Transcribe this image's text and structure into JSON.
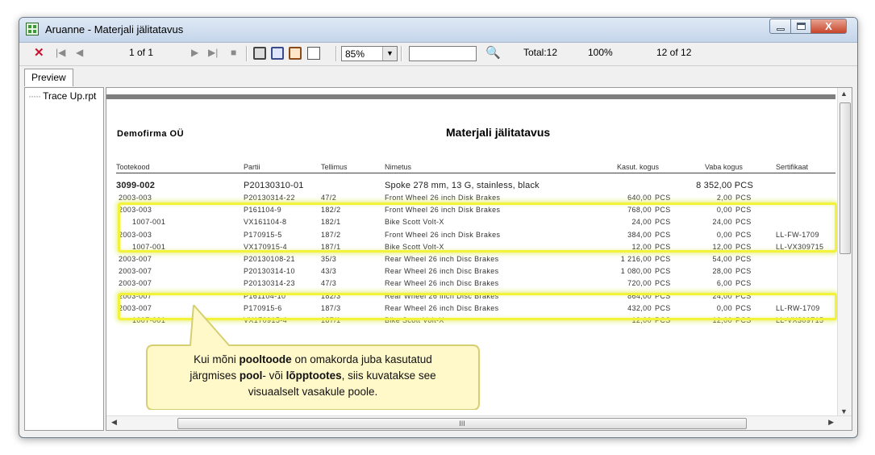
{
  "window": {
    "title": "Aruanne - Materjali jälitatavus",
    "min_label": "",
    "max_label": "",
    "close_label": "X"
  },
  "toolbar": {
    "close_symbol": "✕",
    "first_symbol": "|◀",
    "prev_symbol": "◀",
    "page_indicator": "1 of 1",
    "next_symbol": "▶",
    "last_symbol": "▶|",
    "stop_symbol": "■",
    "zoom_value": "85%",
    "search_value": "",
    "find_symbol": "🔍",
    "total": "Total:12",
    "percent": "100%",
    "records": "12 of 12"
  },
  "tabs": [
    {
      "label": "Preview"
    }
  ],
  "tree": {
    "item": "Trace Up.rpt"
  },
  "report": {
    "company": "Demofirma OÜ",
    "title": "Materjali jälitatavus",
    "columns": {
      "code": "Tootekood",
      "lot": "Partii",
      "order": "Tellimus",
      "name": "Nimetus",
      "used": "Kasut. kogus",
      "free": "Vaba kogus",
      "cert": "Sertifikaat"
    },
    "main_row": {
      "code": "3099-002",
      "lot": "P20130310-01",
      "name": "Spoke 278 mm, 13 G, stainless, black",
      "free": "8 352,00 PCS"
    },
    "rows": [
      {
        "code": "2003-003",
        "lot": "P20130314-22",
        "order": "47/2",
        "name": "Front Wheel 26 inch Disk Brakes",
        "used": "640,00",
        "used_unit": "PCS",
        "free": "2,00",
        "free_unit": "PCS",
        "cert": ""
      },
      {
        "code": "2003-003",
        "lot": "P161104-9",
        "order": "182/2",
        "name": "Front Wheel 26 inch Disk Brakes",
        "used": "768,00",
        "used_unit": "PCS",
        "free": "0,00",
        "free_unit": "PCS",
        "cert": ""
      },
      {
        "code": "1007-001",
        "lot": "VX161104-8",
        "order": "182/1",
        "name": "Bike Scott Volt-X",
        "used": "24,00",
        "used_unit": "PCS",
        "free": "24,00",
        "free_unit": "PCS",
        "cert": ""
      },
      {
        "code": "2003-003",
        "lot": "P170915-5",
        "order": "187/2",
        "name": "Front Wheel 26 inch Disk Brakes",
        "used": "384,00",
        "used_unit": "PCS",
        "free": "0,00",
        "free_unit": "PCS",
        "cert": "LL-FW-1709"
      },
      {
        "code": "1007-001",
        "lot": "VX170915-4",
        "order": "187/1",
        "name": "Bike Scott Volt-X",
        "used": "12,00",
        "used_unit": "PCS",
        "free": "12,00",
        "free_unit": "PCS",
        "cert": "LL-VX309715"
      },
      {
        "code": "2003-007",
        "lot": "P20130108-21",
        "order": "35/3",
        "name": "Rear Wheel 26 inch Disc Brakes",
        "used": "1 216,00",
        "used_unit": "PCS",
        "free": "54,00",
        "free_unit": "PCS",
        "cert": ""
      },
      {
        "code": "2003-007",
        "lot": "P20130314-10",
        "order": "43/3",
        "name": "Rear Wheel 26 inch Disc Brakes",
        "used": "1 080,00",
        "used_unit": "PCS",
        "free": "28,00",
        "free_unit": "PCS",
        "cert": ""
      },
      {
        "code": "2003-007",
        "lot": "P20130314-23",
        "order": "47/3",
        "name": "Rear Wheel 26 inch Disc Brakes",
        "used": "720,00",
        "used_unit": "PCS",
        "free": "6,00",
        "free_unit": "PCS",
        "cert": ""
      },
      {
        "code": "2003-007",
        "lot": "P161104-10",
        "order": "182/3",
        "name": "Rear Wheel 26 inch Disc Brakes",
        "used": "864,00",
        "used_unit": "PCS",
        "free": "24,00",
        "free_unit": "PCS",
        "cert": ""
      },
      {
        "code": "2003-007",
        "lot": "P170915-6",
        "order": "187/3",
        "name": "Rear Wheel 26 inch Disc Brakes",
        "used": "432,00",
        "used_unit": "PCS",
        "free": "0,00",
        "free_unit": "PCS",
        "cert": "LL-RW-1709"
      },
      {
        "code": "1007-001",
        "lot": "VX170915-4",
        "order": "187/1",
        "name": "Bike Scott Volt-X",
        "used": "12,00",
        "used_unit": "PCS",
        "free": "12,00",
        "free_unit": "PCS",
        "cert": "LL-VX309715"
      }
    ]
  },
  "hscroll_label": "III",
  "callout": {
    "line1_a": "Kui mõni ",
    "line1_b": "pooltoode",
    "line1_c": " on omakorda juba kasutatud",
    "line2_a": "järgmises ",
    "line2_b": "pool",
    "line2_c": "- või ",
    "line2_d": "lõpptootes",
    "line2_e": ", siis kuvatakse see",
    "line3": "visuaalselt vasakule poole."
  },
  "colors": {
    "highlight": "#f2f23a",
    "callout_fill": "#fff8c9",
    "callout_stroke": "#d6cf72",
    "close_button": "#c7452a"
  }
}
